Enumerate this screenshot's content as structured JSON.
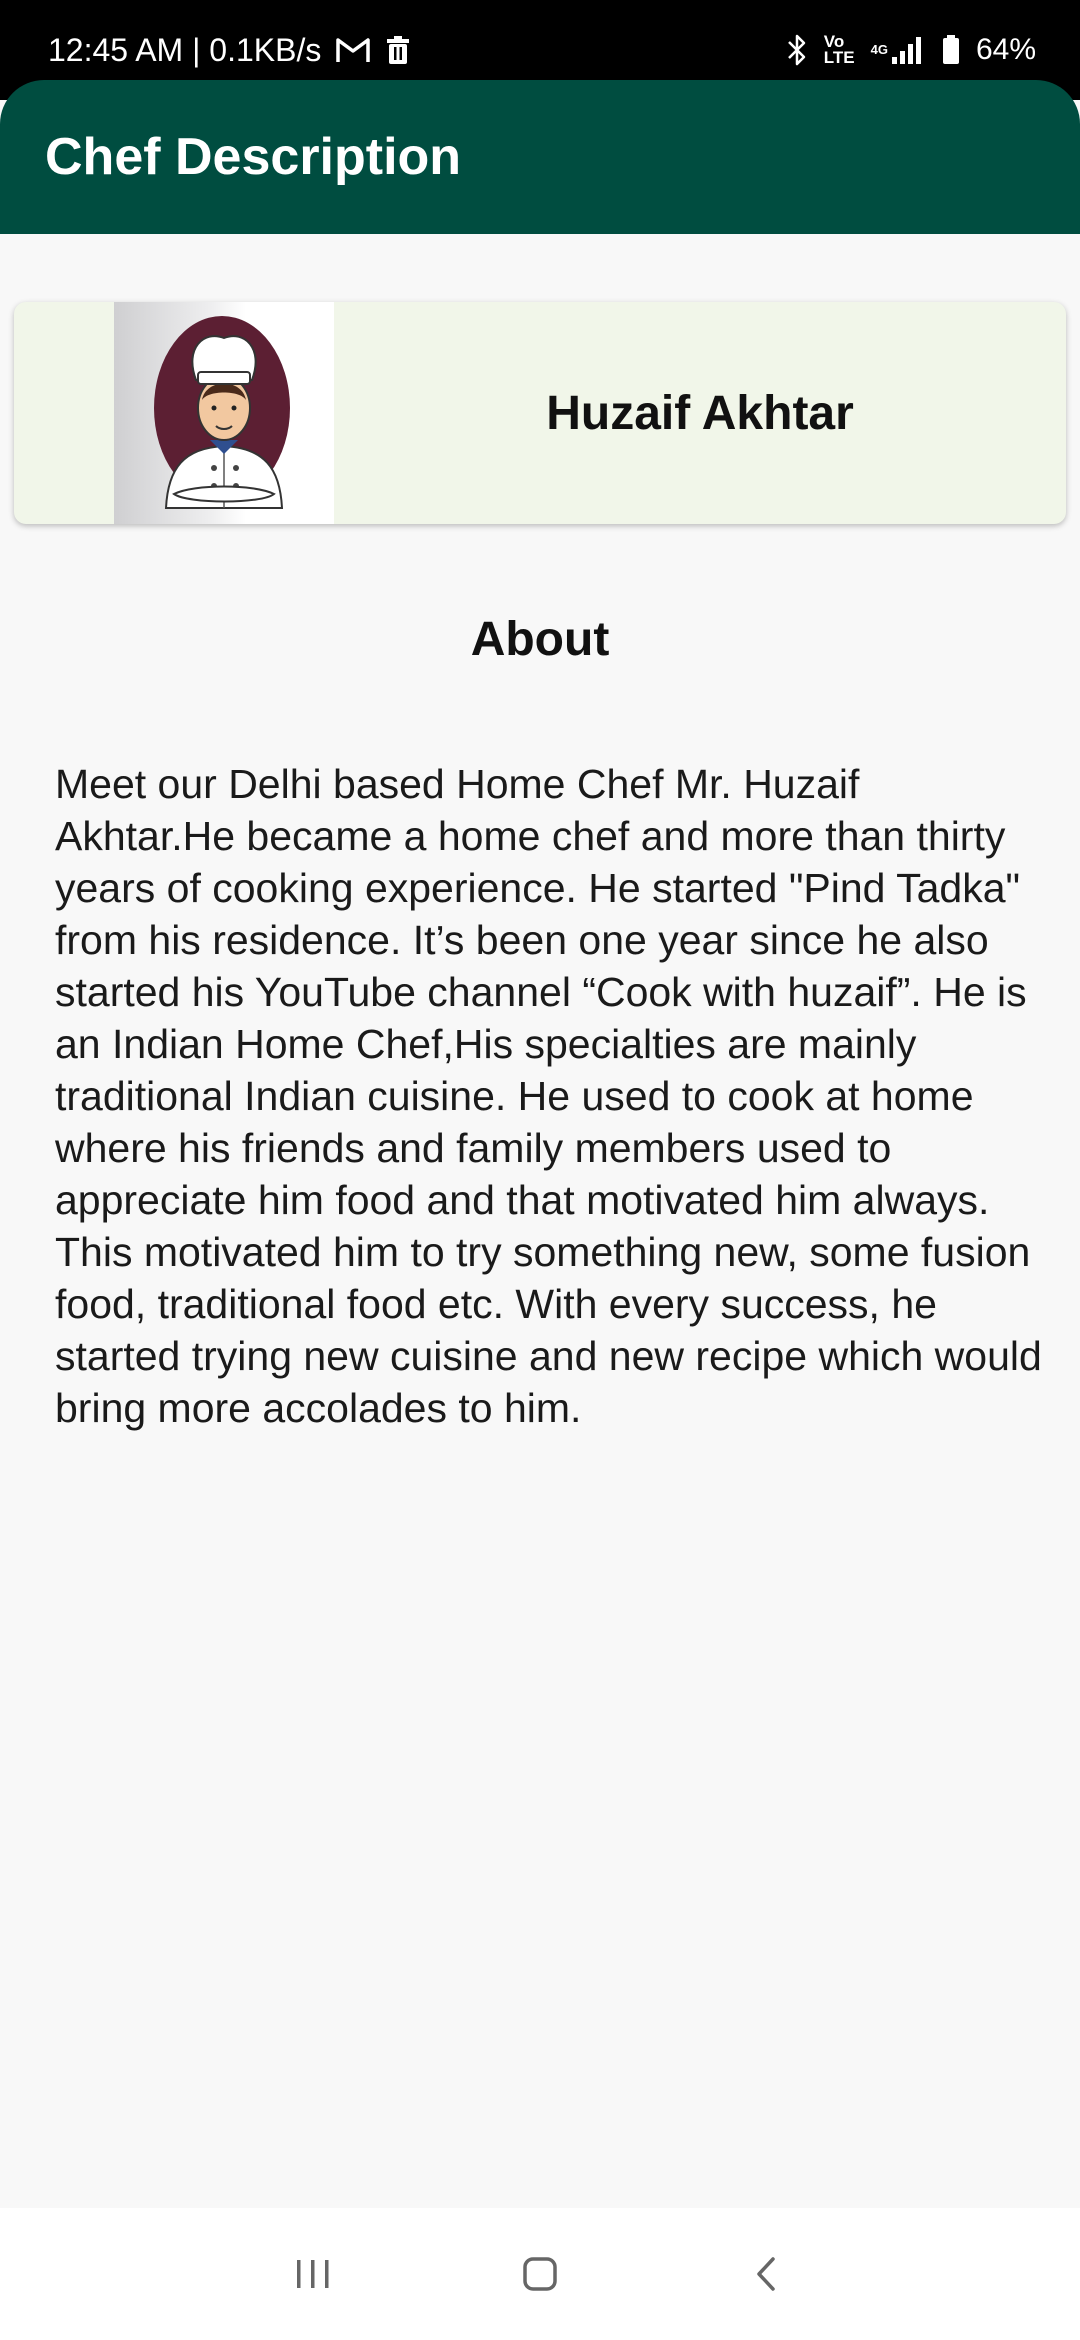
{
  "status_bar": {
    "time_speed": "12:45 AM | 0.1KB/s",
    "volte_top": "Vo",
    "volte_bottom": "LTE",
    "network": "4G",
    "battery": "64%"
  },
  "app_bar": {
    "title": "Chef Description"
  },
  "chef": {
    "name": "Huzaif Akhtar"
  },
  "about": {
    "heading": "About",
    "text": "Meet our Delhi based Home Chef Mr. Huzaif Akhtar.He became a home chef and more than thirty years of cooking experience. He started \"Pind Tadka\" from his residence. It’s been one year since he also started his YouTube channel “Cook with huzaif”. He is an Indian Home Chef,His specialties are mainly traditional Indian cuisine. He used to cook at home where his friends and family members used to appreciate him food and that motivated him always. This motivated him to try something new, some fusion food, traditional food etc. With every success, he started trying new cuisine and new recipe which would bring more accolades to him."
  },
  "icons": {
    "status_left": [
      "gmail-icon",
      "trash-icon"
    ],
    "status_right": [
      "bluetooth-icon",
      "volte-icon",
      "signal-icon",
      "battery-icon"
    ],
    "nav": [
      "recent-apps-icon",
      "home-icon",
      "back-icon"
    ]
  },
  "colors": {
    "app_bar": "#004d40",
    "card_background": "#f1f6e9",
    "page_background": "#f8f8f8",
    "chef_backdrop": "#5c1f33"
  }
}
